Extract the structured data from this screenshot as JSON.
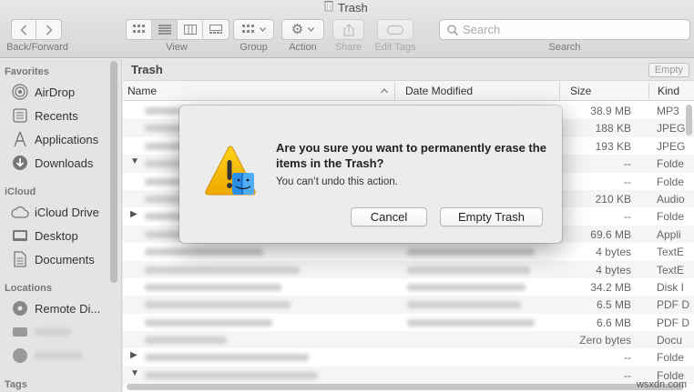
{
  "window": {
    "title": "Trash"
  },
  "toolbar": {
    "back_forward_label": "Back/Forward",
    "view_label": "View",
    "group_label": "Group",
    "action_label": "Action",
    "share_label": "Share",
    "edit_tags_label": "Edit Tags",
    "search_label": "Search",
    "search_placeholder": "Search"
  },
  "sidebar": {
    "favorites_header": "Favorites",
    "favorites": [
      {
        "label": "AirDrop",
        "icon": "airdrop-icon"
      },
      {
        "label": "Recents",
        "icon": "recents-icon"
      },
      {
        "label": "Applications",
        "icon": "applications-icon"
      },
      {
        "label": "Downloads",
        "icon": "downloads-icon"
      }
    ],
    "icloud_header": "iCloud",
    "icloud": [
      {
        "label": "iCloud Drive",
        "icon": "cloud-icon"
      },
      {
        "label": "Desktop",
        "icon": "desktop-icon"
      },
      {
        "label": "Documents",
        "icon": "documents-icon"
      }
    ],
    "locations_header": "Locations",
    "locations": [
      {
        "label": "Remote Di...",
        "icon": "remote-disc-icon"
      }
    ],
    "tags_header": "Tags"
  },
  "main": {
    "path_title": "Trash",
    "empty_button": "Empty",
    "columns": {
      "name": "Name",
      "date": "Date Modified",
      "size": "Size",
      "kind": "Kind"
    },
    "rows": [
      {
        "size": "38.9 MB",
        "kind": "MP3"
      },
      {
        "size": "188 KB",
        "kind": "JPEG"
      },
      {
        "size": "193 KB",
        "kind": "JPEG"
      },
      {
        "size": "--",
        "kind": "Folde",
        "disclosure": "down"
      },
      {
        "size": "--",
        "kind": "Folde"
      },
      {
        "size": "210 KB",
        "kind": "Audio"
      },
      {
        "size": "--",
        "kind": "Folde",
        "disclosure": "right"
      },
      {
        "size": "69.6 MB",
        "kind": "Appli"
      },
      {
        "size": "4 bytes",
        "kind": "TextE"
      },
      {
        "size": "4 bytes",
        "kind": "TextE"
      },
      {
        "size": "34.2 MB",
        "kind": "Disk I"
      },
      {
        "size": "6.5 MB",
        "kind": "PDF D"
      },
      {
        "size": "6.6 MB",
        "kind": "PDF D"
      },
      {
        "size": "Zero bytes",
        "kind": "Docu"
      },
      {
        "size": "--",
        "kind": "Folde",
        "disclosure": "right"
      },
      {
        "size": "--",
        "kind": "Folde",
        "disclosure": "down"
      }
    ]
  },
  "dialog": {
    "title": "Are you sure you want to permanently erase the items in the Trash?",
    "message": "You can’t undo this action.",
    "cancel_label": "Cancel",
    "confirm_label": "Empty Trash",
    "icon": "warning-finder-icon"
  },
  "watermark": "wsxdn.com"
}
